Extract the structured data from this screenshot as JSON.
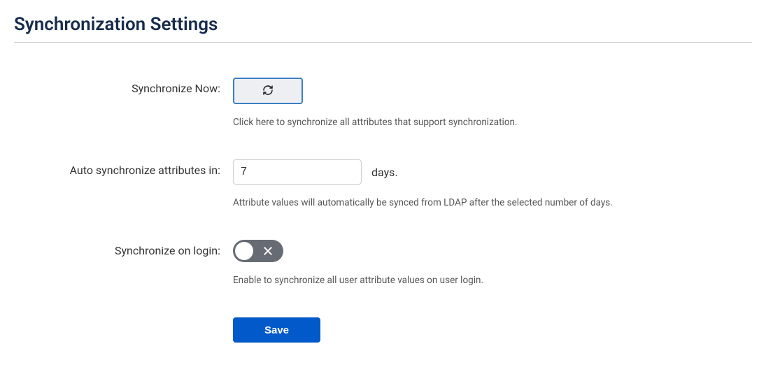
{
  "page": {
    "title": "Synchronization Settings"
  },
  "form": {
    "syncNow": {
      "label": "Synchronize Now:",
      "help": "Click here to synchronize all attributes that support synchronization."
    },
    "autoSync": {
      "label": "Auto synchronize attributes in:",
      "value": "7",
      "unit": "days.",
      "help": "Attribute values will automatically be synced from LDAP after the selected number of days."
    },
    "syncOnLogin": {
      "label": "Synchronize on login:",
      "state": "off",
      "help": "Enable to synchronize all user attribute values on user login."
    },
    "save": {
      "label": "Save"
    }
  }
}
